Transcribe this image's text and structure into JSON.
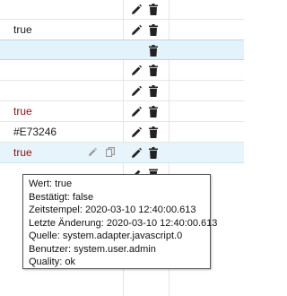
{
  "rows": [
    {
      "value": "",
      "actions": [
        "edit",
        "delete"
      ]
    },
    {
      "value": "true",
      "value_color": "dark",
      "actions": [
        "edit",
        "delete"
      ]
    },
    {
      "value": "",
      "actions": [
        "delete"
      ],
      "selected": true
    },
    {
      "value": "",
      "actions": [
        "edit",
        "delete"
      ]
    },
    {
      "value": "",
      "actions": [
        "edit",
        "delete"
      ]
    },
    {
      "value": "true",
      "value_color": "red",
      "actions": [
        "edit",
        "delete"
      ]
    },
    {
      "value": "#E73246",
      "value_color": "dark",
      "actions": [
        "edit",
        "delete"
      ]
    },
    {
      "value": "true",
      "value_color": "red",
      "actions": [
        "edit",
        "delete"
      ],
      "hovered": true,
      "row_tools": [
        "edit",
        "copy"
      ]
    }
  ],
  "tooltip": {
    "lines": [
      "Wert: true",
      "Bestätigt: false",
      "Zeitstempel: 2020-03-10 12:40:00.613",
      "Letzte Änderung: 2020-03-10 12:40:00.613",
      "Quelle: system.adapter.javascript.0",
      "Benutzer: system.user.admin",
      "Quality: ok"
    ]
  },
  "colors": {
    "value_dark": "#1b1b1b",
    "value_red": "#8b1010",
    "selected_row": "#e3f2fb",
    "hover_row": "#e8f4fb",
    "icon": "#222222"
  }
}
